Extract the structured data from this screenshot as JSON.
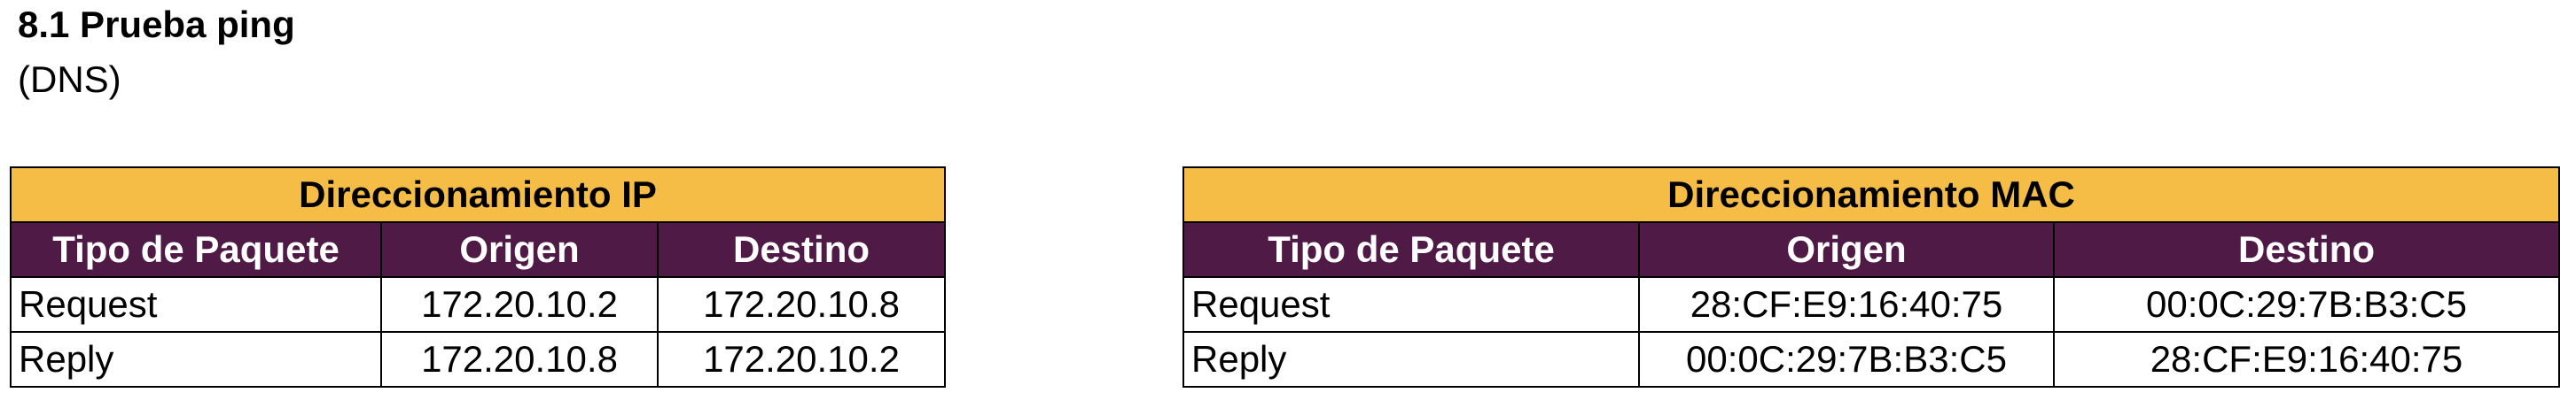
{
  "section": {
    "title": "8.1 Prueba ping",
    "subtitle": "(DNS)"
  },
  "theme": {
    "caption_bg": "#f5bd45",
    "header_bg": "#4f1a45",
    "header_text": "#ffffff"
  },
  "ip_table": {
    "caption": "Direccionamiento IP",
    "headers": [
      "Tipo de Paquete",
      "Origen",
      "Destino"
    ],
    "rows": [
      [
        "Request",
        "172.20.10.2",
        "172.20.10.8"
      ],
      [
        "Reply",
        "172.20.10.8",
        "172.20.10.2"
      ]
    ]
  },
  "mac_table": {
    "caption": "Direccionamiento MAC",
    "headers": [
      "Tipo de Paquete",
      "Origen",
      "Destino"
    ],
    "rows": [
      [
        "Request",
        "28:CF:E9:16:40:75",
        "00:0C:29:7B:B3:C5"
      ],
      [
        "Reply",
        "00:0C:29:7B:B3:C5",
        "28:CF:E9:16:40:75"
      ]
    ]
  }
}
